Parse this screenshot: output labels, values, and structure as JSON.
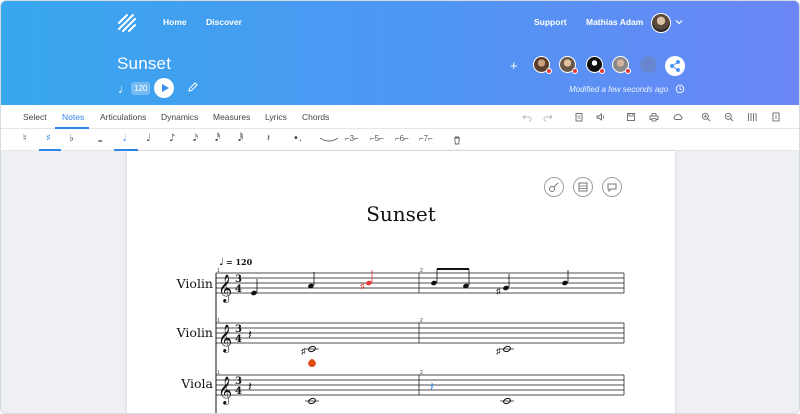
{
  "nav": {
    "home": "Home",
    "discover": "Discover",
    "support": "Support",
    "user": "Mathias Adam"
  },
  "score": {
    "title": "Sunset",
    "tempo": "120",
    "modified": "Modified a few seconds ago"
  },
  "tabs": [
    {
      "label": "Select"
    },
    {
      "label": "Notes"
    },
    {
      "label": "Articulations"
    },
    {
      "label": "Dynamics"
    },
    {
      "label": "Measures"
    },
    {
      "label": "Lyrics"
    },
    {
      "label": "Chords"
    }
  ],
  "tuplets": [
    "3",
    "5",
    "6",
    "7"
  ],
  "page": {
    "title": "Sunset",
    "tempo_mark": "= 120",
    "instruments": [
      "Violin",
      "Violin",
      "Viola"
    ],
    "measure_numbers": [
      "1",
      "2"
    ]
  },
  "colors": {
    "accent": "#2f86e8",
    "selected_note": "#e53935",
    "header_start": "#37a7ee",
    "header_end": "#6b86f6"
  }
}
